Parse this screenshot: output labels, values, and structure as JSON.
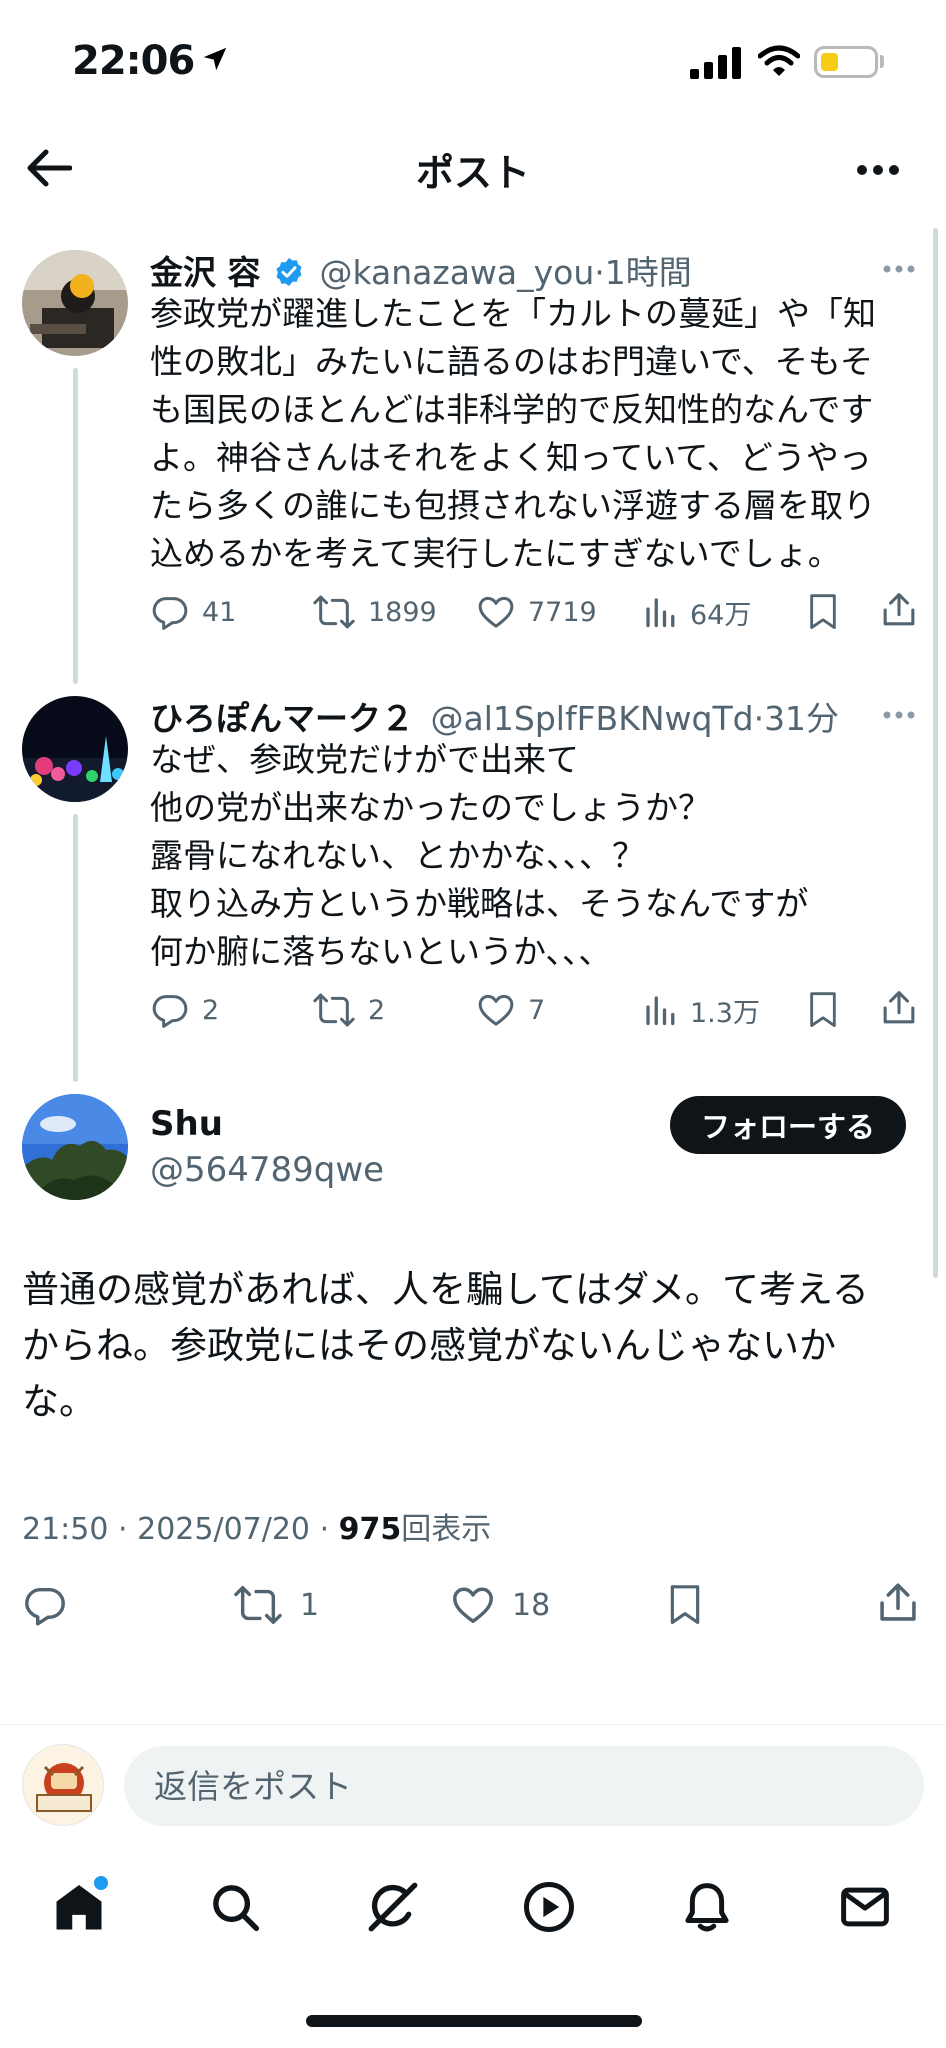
{
  "status_bar": {
    "time": "22:06"
  },
  "header": {
    "title": "ポスト"
  },
  "thread": [
    {
      "name": "金沢 容",
      "handle": "@kanazawa_you",
      "separator": "·",
      "time": "1時間",
      "verified": true,
      "lines": [
        "参政党が躍進したことを「カルトの蔓延」や「知",
        "性の敗北」みたいに語るのはお門違いで、そもそ",
        "も国民のほとんどは非科学的で反知性的なんです",
        "よ。神谷さんはそれをよく知っていて、どうやっ",
        "たら多くの誰にも包摂されない浮遊する層を取り",
        "込めるかを考えて実行したにすぎないでしょ。"
      ],
      "replies": "41",
      "reposts": "1899",
      "likes": "7719",
      "views": "64万"
    },
    {
      "name": "ひろぽんマーク２",
      "handle": "@al1SplfFBKNwqTd",
      "separator": "·",
      "time": "31分",
      "verified": false,
      "lines": [
        "なぜ、参政党だけがで出来て",
        "他の党が出来なかったのでしょうか？",
        "露骨になれない、とかかな、、、？",
        "取り込み方というか戦略は、そうなんですが",
        "何か腑に落ちないというか、、、"
      ],
      "replies": "2",
      "reposts": "2",
      "likes": "7",
      "views": "1.3万"
    }
  ],
  "main_post": {
    "name": "Shu",
    "handle": "@564789qwe",
    "follow_label": "フォローする",
    "lines": [
      "普通の感覚があれば、人を騙してはダメ。て考える",
      "からね。参政党にはその感覚がないんじゃないか",
      "な。"
    ],
    "time": "21:50",
    "separator": "·",
    "date": "2025/07/20",
    "views_count": "975",
    "views_label": "回表示",
    "reposts": "1",
    "likes": "18"
  },
  "reply_bar": {
    "placeholder": "返信をポスト"
  },
  "icons": {
    "nav": [
      "home-icon",
      "search-icon",
      "grok-icon",
      "video-icon",
      "notifications-icon",
      "messages-icon"
    ]
  },
  "colors": {
    "accent": "#1d9bf0",
    "text": "#0f1419",
    "muted": "#536471",
    "battery": "#f7cc14"
  }
}
